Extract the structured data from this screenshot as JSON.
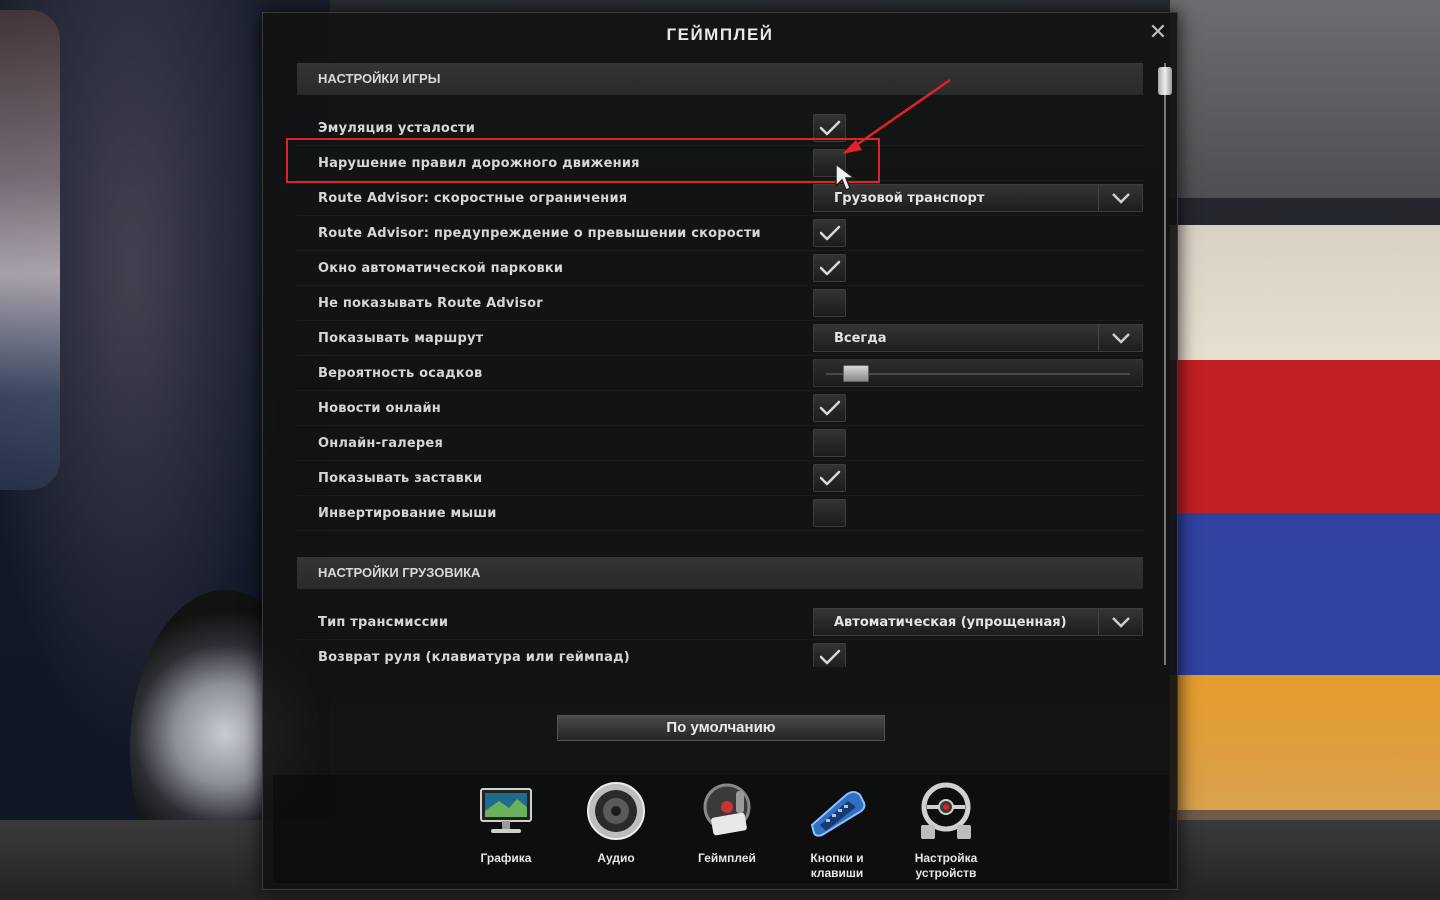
{
  "dialog": {
    "title": "ГЕЙМПЛЕЙ",
    "close_glyph": "✕"
  },
  "sections": {
    "game": {
      "header": "НАСТРОЙКИ ИГРЫ",
      "rows": [
        {
          "label": "Эмуляция усталости",
          "control": "checkbox",
          "checked": true
        },
        {
          "label": "Нарушение правил дорожного движения",
          "control": "checkbox",
          "checked": false
        },
        {
          "label": "Route Advisor: скоростные ограничения",
          "control": "dropdown",
          "value": "Грузовой транспорт"
        },
        {
          "label": "Route Advisor: предупреждение о превышении скорости",
          "control": "checkbox",
          "checked": true
        },
        {
          "label": "Окно автоматической парковки",
          "control": "checkbox",
          "checked": true
        },
        {
          "label": "Не показывать Route Advisor",
          "control": "checkbox",
          "checked": false
        },
        {
          "label": "Показывать маршрут",
          "control": "dropdown",
          "value": "Всегда"
        },
        {
          "label": "Вероятность осадков",
          "control": "slider",
          "level": 0.1
        },
        {
          "label": "Новости онлайн",
          "control": "checkbox",
          "checked": true
        },
        {
          "label": "Онлайн-галерея",
          "control": "checkbox",
          "checked": false
        },
        {
          "label": "Показывать заставки",
          "control": "checkbox",
          "checked": true
        },
        {
          "label": "Инвертирование мыши",
          "control": "checkbox",
          "checked": false
        }
      ]
    },
    "truck": {
      "header": "НАСТРОЙКИ ГРУЗОВИКА",
      "rows": [
        {
          "label": "Тип трансмиссии",
          "control": "dropdown",
          "value": "Автоматическая (упрощенная)"
        },
        {
          "label": "Возврат руля (клавиатура или геймпад)",
          "control": "checkbox",
          "checked": true
        }
      ]
    }
  },
  "defaults_button": "По умолчанию",
  "nav": [
    {
      "label": "Графика",
      "icon": "monitor-icon"
    },
    {
      "label": "Аудио",
      "icon": "speaker-icon"
    },
    {
      "label": "Геймплей",
      "icon": "gameplay-icon"
    },
    {
      "label": "Кнопки и клавиши",
      "icon": "keyboard-icon"
    },
    {
      "label": "Настройка устройств",
      "icon": "steering-wheel-icon"
    }
  ],
  "colors": {
    "highlight": "#e0222a",
    "panel": "#121212",
    "text": "#d6d6d6"
  }
}
